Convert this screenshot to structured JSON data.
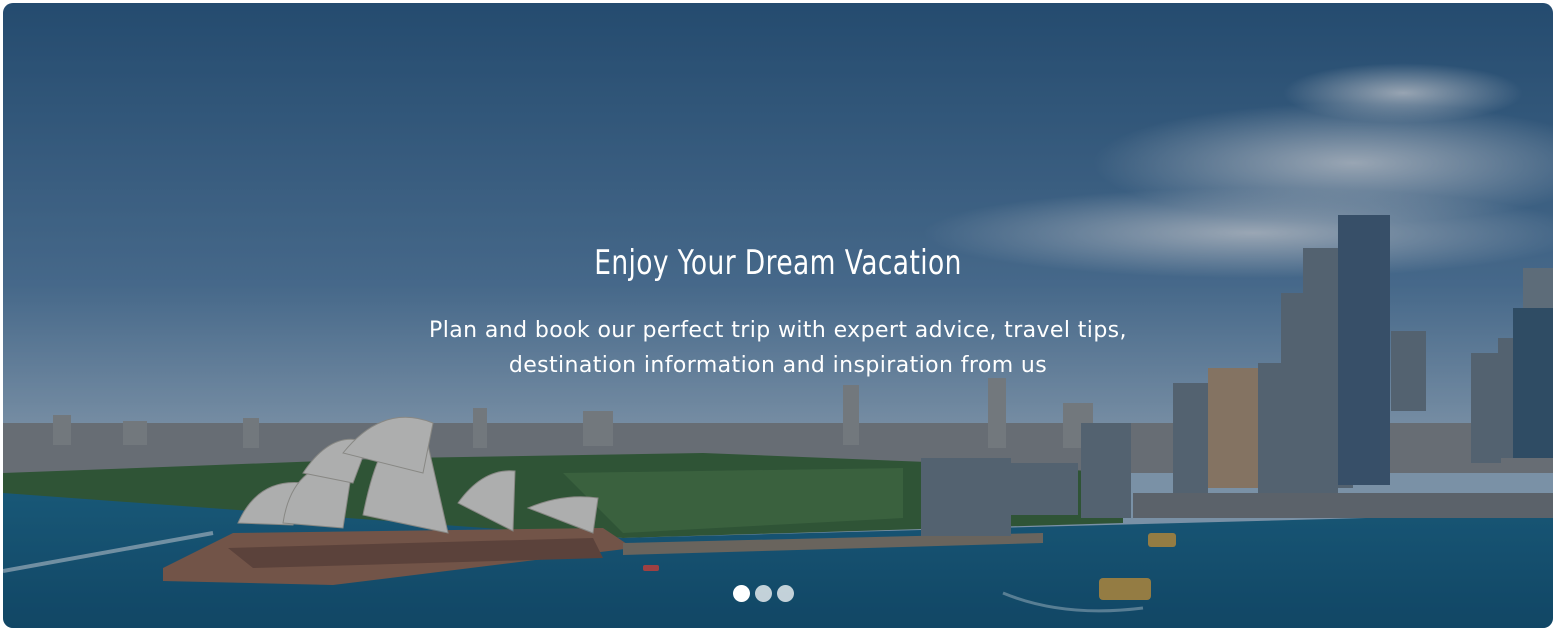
{
  "hero": {
    "headline": "Enjoy Your Dream Vacation",
    "subtext_line1": "Plan and book our perfect trip with expert advice, travel tips,",
    "subtext_line2": "destination information and  inspiration from us"
  },
  "carousel": {
    "slide_count": 3,
    "active_index": 0
  },
  "colors": {
    "sky_top": "#3a6a93",
    "sky_horizon": "#a9c3d8",
    "water": "#1f6f93",
    "text": "#ffffff"
  }
}
